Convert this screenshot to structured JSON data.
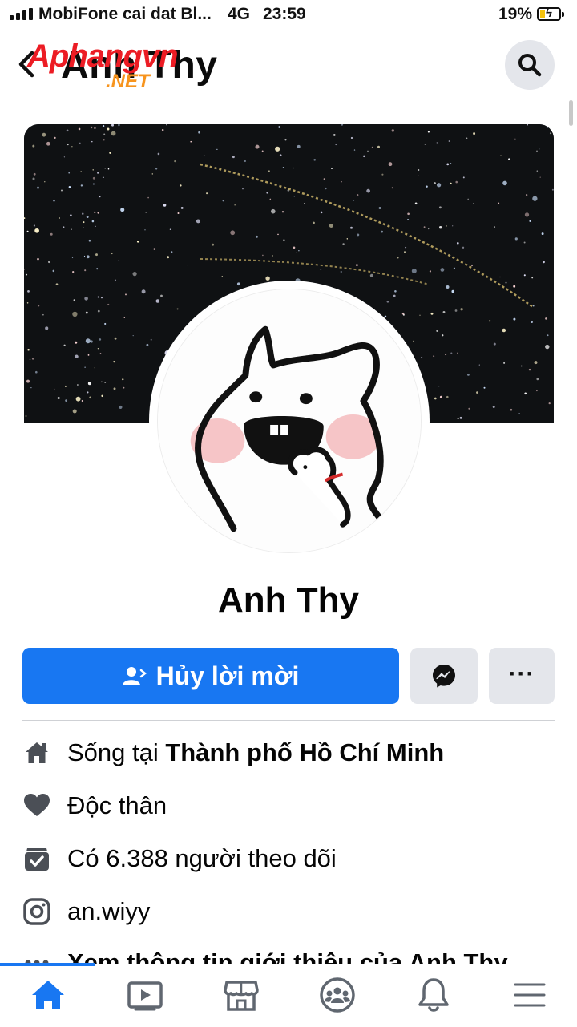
{
  "status_bar": {
    "carrier": "MobiFone cai dat Bl...",
    "network": "4G",
    "time": "23:59",
    "battery": "19%",
    "battery_level": 0.19
  },
  "header": {
    "title": "Anh Thy",
    "watermark": "Aphangvn",
    "watermark_suffix": ".NET"
  },
  "profile": {
    "name": "Anh Thy"
  },
  "actions": {
    "primary_label": "Hủy lời mời",
    "messenger_icon": "messenger-icon",
    "more_label": "···"
  },
  "about": {
    "lives_prefix": "Sống tại ",
    "lives_city": "Thành phố Hồ Chí Minh",
    "relationship": "Độc thân",
    "followers": "Có 6.388 người theo dõi",
    "instagram": "an.wiyy",
    "see_more": "Xem thông tin giới thiệu của Anh Thy"
  },
  "tabs": [
    {
      "name": "home",
      "icon": "home-icon",
      "active": true
    },
    {
      "name": "watch",
      "icon": "video-icon",
      "active": false
    },
    {
      "name": "marketplace",
      "icon": "store-icon",
      "active": false
    },
    {
      "name": "groups",
      "icon": "groups-icon",
      "active": false
    },
    {
      "name": "notifications",
      "icon": "bell-icon",
      "active": false
    },
    {
      "name": "menu",
      "icon": "menu-icon",
      "active": false
    }
  ],
  "colors": {
    "primary": "#1877f2",
    "button_gray": "#e4e6eb",
    "watermark_red": "#ec1c24",
    "watermark_orange": "#f7941d"
  }
}
